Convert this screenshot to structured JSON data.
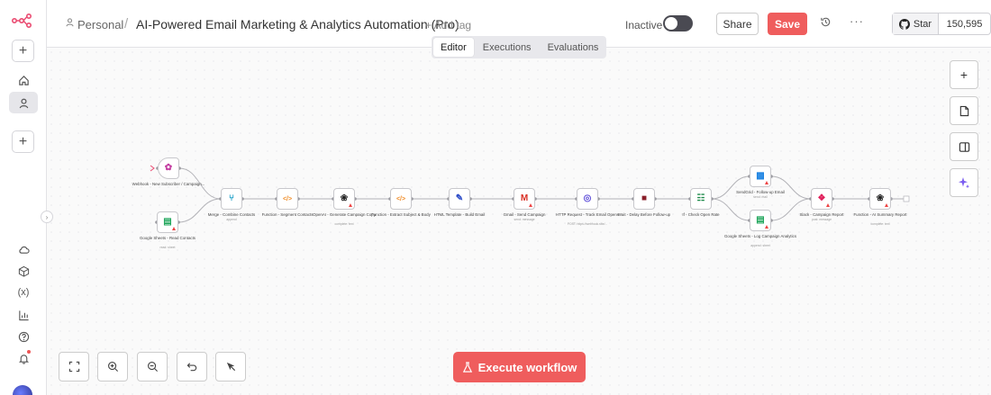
{
  "app": {
    "brand_color": "#ef5d5d"
  },
  "header": {
    "owner": "Personal",
    "separator": "/",
    "title": "AI-Powered Email Marketing & Analytics Automation (Pro)",
    "add_tag": "+ Add tag",
    "status_label": "Inactive",
    "share_label": "Share",
    "save_label": "Save",
    "github_star_label": "Star",
    "github_star_count": "150,595"
  },
  "tabs": [
    {
      "label": "Editor",
      "active": true
    },
    {
      "label": "Executions",
      "active": false
    },
    {
      "label": "Evaluations",
      "active": false
    }
  ],
  "execute_label": "Execute workflow",
  "sidebar_icons": [
    "add-icon",
    "home-icon",
    "user-icon",
    "add-icon",
    "cloud-icon",
    "package-icon",
    "variables-icon",
    "insights-icon",
    "help-icon",
    "bell-icon"
  ],
  "nodes": [
    {
      "id": "webhook",
      "label": "Webhook - New Subscriber / Campaign...",
      "sub": "",
      "glyph": "✿",
      "color": "#c33ba0",
      "icon": "webhook-icon",
      "warn": false
    },
    {
      "id": "sheets-read",
      "label": "Google Sheets - Read Contacts",
      "sub": "read: sheet",
      "glyph": "▤",
      "color": "#1ea55a",
      "icon": "google-sheets-icon",
      "warn": true
    },
    {
      "id": "merge",
      "label": "Merge - Combine Contacts",
      "sub": "append",
      "glyph": "⑂",
      "color": "#1ea0c8",
      "icon": "merge-icon",
      "warn": false
    },
    {
      "id": "fn-segment",
      "label": "Function - Segment Contacts",
      "sub": "",
      "glyph": "</>",
      "color": "#f08a24",
      "icon": "code-icon",
      "warn": false
    },
    {
      "id": "openai-copy",
      "label": "OpenAI - Generate Campaign Copy",
      "sub": "complete: text",
      "glyph": "❀",
      "color": "#222222",
      "icon": "openai-icon",
      "warn": true
    },
    {
      "id": "fn-extract",
      "label": "Function - Extract Subject & Body",
      "sub": "",
      "glyph": "</>",
      "color": "#f08a24",
      "icon": "code-icon",
      "warn": false
    },
    {
      "id": "html-template",
      "label": "HTML Template - Build Email",
      "sub": "",
      "glyph": "✎",
      "color": "#2a4ac7",
      "icon": "html-icon",
      "warn": false
    },
    {
      "id": "gmail-send",
      "label": "Gmail - Send Campaign",
      "sub": "send: message",
      "glyph": "M",
      "color": "#d93025",
      "icon": "gmail-icon",
      "warn": true
    },
    {
      "id": "http-track",
      "label": "HTTP Request - Track Email Opens",
      "sub": "POST: https://webhook.site/...",
      "glyph": "◎",
      "color": "#5b4bd8",
      "icon": "http-icon",
      "warn": false
    },
    {
      "id": "wait",
      "label": "Wait - Delay Before Follow-up",
      "sub": "",
      "glyph": "■",
      "color": "#8a1f2a",
      "icon": "wait-icon",
      "warn": false
    },
    {
      "id": "if-open",
      "label": "If - Check Open Rate",
      "sub": "",
      "glyph": "☷",
      "color": "#1d8a4a",
      "icon": "if-icon",
      "warn": false
    },
    {
      "id": "sendgrid",
      "label": "SendGrid - Follow-up Email",
      "sub": "send: mail",
      "glyph": "▩",
      "color": "#1a82e2",
      "icon": "sendgrid-icon",
      "warn": true
    },
    {
      "id": "sheets-log",
      "label": "Google Sheets - Log Campaign Analytics",
      "sub": "append: sheet",
      "glyph": "▤",
      "color": "#1ea55a",
      "icon": "google-sheets-icon",
      "warn": true
    },
    {
      "id": "slack",
      "label": "Slack - Campaign Report",
      "sub": "post: message",
      "glyph": "❖",
      "color": "#e01e5a",
      "icon": "slack-icon",
      "warn": true
    },
    {
      "id": "fn-summary",
      "label": "Function - AI Summary Report",
      "sub": "complete: text",
      "glyph": "❀",
      "color": "#222222",
      "icon": "openai-icon",
      "warn": true
    }
  ]
}
